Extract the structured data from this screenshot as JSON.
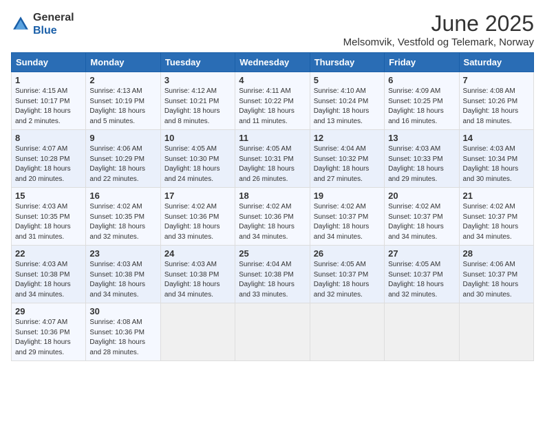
{
  "logo": {
    "line1": "General",
    "line2": "Blue"
  },
  "title": "June 2025",
  "subtitle": "Melsomvik, Vestfold og Telemark, Norway",
  "weekdays": [
    "Sunday",
    "Monday",
    "Tuesday",
    "Wednesday",
    "Thursday",
    "Friday",
    "Saturday"
  ],
  "weeks": [
    [
      {
        "day": "1",
        "info": "Sunrise: 4:15 AM\nSunset: 10:17 PM\nDaylight: 18 hours\nand 2 minutes."
      },
      {
        "day": "2",
        "info": "Sunrise: 4:13 AM\nSunset: 10:19 PM\nDaylight: 18 hours\nand 5 minutes."
      },
      {
        "day": "3",
        "info": "Sunrise: 4:12 AM\nSunset: 10:21 PM\nDaylight: 18 hours\nand 8 minutes."
      },
      {
        "day": "4",
        "info": "Sunrise: 4:11 AM\nSunset: 10:22 PM\nDaylight: 18 hours\nand 11 minutes."
      },
      {
        "day": "5",
        "info": "Sunrise: 4:10 AM\nSunset: 10:24 PM\nDaylight: 18 hours\nand 13 minutes."
      },
      {
        "day": "6",
        "info": "Sunrise: 4:09 AM\nSunset: 10:25 PM\nDaylight: 18 hours\nand 16 minutes."
      },
      {
        "day": "7",
        "info": "Sunrise: 4:08 AM\nSunset: 10:26 PM\nDaylight: 18 hours\nand 18 minutes."
      }
    ],
    [
      {
        "day": "8",
        "info": "Sunrise: 4:07 AM\nSunset: 10:28 PM\nDaylight: 18 hours\nand 20 minutes."
      },
      {
        "day": "9",
        "info": "Sunrise: 4:06 AM\nSunset: 10:29 PM\nDaylight: 18 hours\nand 22 minutes."
      },
      {
        "day": "10",
        "info": "Sunrise: 4:05 AM\nSunset: 10:30 PM\nDaylight: 18 hours\nand 24 minutes."
      },
      {
        "day": "11",
        "info": "Sunrise: 4:05 AM\nSunset: 10:31 PM\nDaylight: 18 hours\nand 26 minutes."
      },
      {
        "day": "12",
        "info": "Sunrise: 4:04 AM\nSunset: 10:32 PM\nDaylight: 18 hours\nand 27 minutes."
      },
      {
        "day": "13",
        "info": "Sunrise: 4:03 AM\nSunset: 10:33 PM\nDaylight: 18 hours\nand 29 minutes."
      },
      {
        "day": "14",
        "info": "Sunrise: 4:03 AM\nSunset: 10:34 PM\nDaylight: 18 hours\nand 30 minutes."
      }
    ],
    [
      {
        "day": "15",
        "info": "Sunrise: 4:03 AM\nSunset: 10:35 PM\nDaylight: 18 hours\nand 31 minutes."
      },
      {
        "day": "16",
        "info": "Sunrise: 4:02 AM\nSunset: 10:35 PM\nDaylight: 18 hours\nand 32 minutes."
      },
      {
        "day": "17",
        "info": "Sunrise: 4:02 AM\nSunset: 10:36 PM\nDaylight: 18 hours\nand 33 minutes."
      },
      {
        "day": "18",
        "info": "Sunrise: 4:02 AM\nSunset: 10:36 PM\nDaylight: 18 hours\nand 34 minutes."
      },
      {
        "day": "19",
        "info": "Sunrise: 4:02 AM\nSunset: 10:37 PM\nDaylight: 18 hours\nand 34 minutes."
      },
      {
        "day": "20",
        "info": "Sunrise: 4:02 AM\nSunset: 10:37 PM\nDaylight: 18 hours\nand 34 minutes."
      },
      {
        "day": "21",
        "info": "Sunrise: 4:02 AM\nSunset: 10:37 PM\nDaylight: 18 hours\nand 34 minutes."
      }
    ],
    [
      {
        "day": "22",
        "info": "Sunrise: 4:03 AM\nSunset: 10:38 PM\nDaylight: 18 hours\nand 34 minutes."
      },
      {
        "day": "23",
        "info": "Sunrise: 4:03 AM\nSunset: 10:38 PM\nDaylight: 18 hours\nand 34 minutes."
      },
      {
        "day": "24",
        "info": "Sunrise: 4:03 AM\nSunset: 10:38 PM\nDaylight: 18 hours\nand 34 minutes."
      },
      {
        "day": "25",
        "info": "Sunrise: 4:04 AM\nSunset: 10:38 PM\nDaylight: 18 hours\nand 33 minutes."
      },
      {
        "day": "26",
        "info": "Sunrise: 4:05 AM\nSunset: 10:37 PM\nDaylight: 18 hours\nand 32 minutes."
      },
      {
        "day": "27",
        "info": "Sunrise: 4:05 AM\nSunset: 10:37 PM\nDaylight: 18 hours\nand 32 minutes."
      },
      {
        "day": "28",
        "info": "Sunrise: 4:06 AM\nSunset: 10:37 PM\nDaylight: 18 hours\nand 30 minutes."
      }
    ],
    [
      {
        "day": "29",
        "info": "Sunrise: 4:07 AM\nSunset: 10:36 PM\nDaylight: 18 hours\nand 29 minutes."
      },
      {
        "day": "30",
        "info": "Sunrise: 4:08 AM\nSunset: 10:36 PM\nDaylight: 18 hours\nand 28 minutes."
      },
      {
        "day": "",
        "info": ""
      },
      {
        "day": "",
        "info": ""
      },
      {
        "day": "",
        "info": ""
      },
      {
        "day": "",
        "info": ""
      },
      {
        "day": "",
        "info": ""
      }
    ]
  ]
}
